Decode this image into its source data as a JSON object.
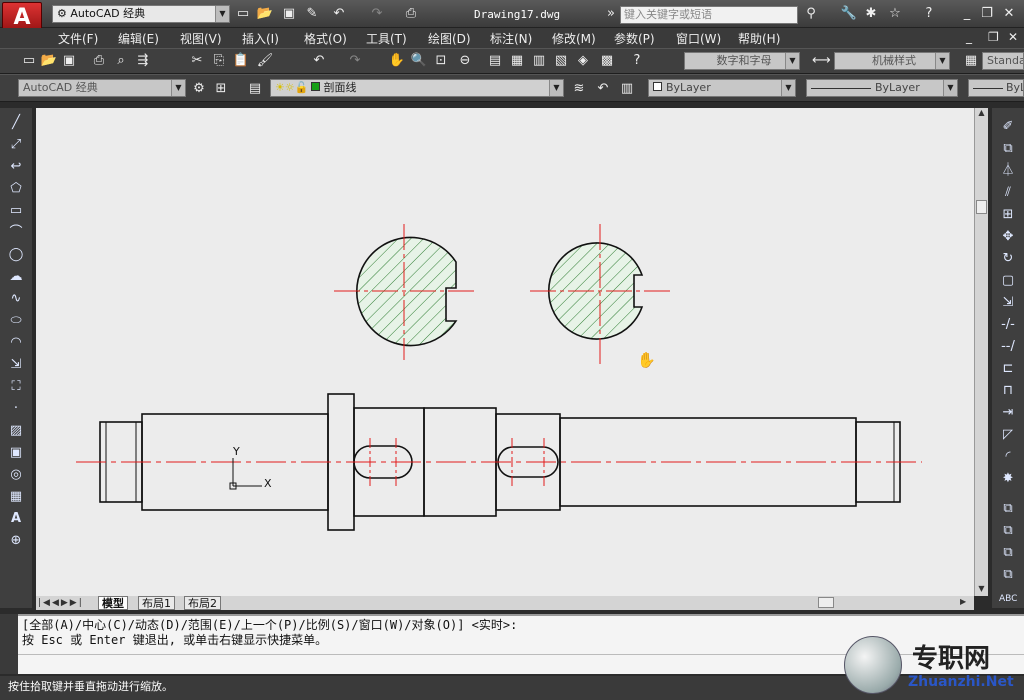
{
  "app": {
    "workspace": "AutoCAD 经典",
    "doc_title": "Drawing17.dwg",
    "search_placeholder": "键入关键字或短语"
  },
  "menu": [
    "文件(F)",
    "编辑(E)",
    "视图(V)",
    "插入(I)",
    "格式(O)",
    "工具(T)",
    "绘图(D)",
    "标注(N)",
    "修改(M)",
    "参数(P)",
    "窗口(W)",
    "帮助(H)"
  ],
  "toolbar": {
    "text_style": "数字和字母",
    "dim_style": "机械样式",
    "table_style": "Standa",
    "workspace_combo": "AutoCAD 经典",
    "layer": "剖面线",
    "color": "ByLayer",
    "linetype": "ByLayer",
    "lineweight": "ByLa"
  },
  "layout_tabs": [
    "模型",
    "布局1",
    "布局2"
  ],
  "command": {
    "line1": "[全部(A)/中心(C)/动态(D)/范围(E)/上一个(P)/比例(S)/窗口(W)/对象(O)] <实时>:",
    "line2": "按 Esc 或 Enter 键退出, 或单击右键显示快捷菜单。"
  },
  "status": "按住拾取键并垂直拖动进行缩放。",
  "watermark": {
    "brand": "专职网",
    "url": "Zhuanzhi.Net"
  },
  "ucs": {
    "x": "X",
    "y": "Y"
  },
  "colors": {
    "hatch": "#2e7d32",
    "center": "#e21b1b",
    "line": "#111111"
  }
}
